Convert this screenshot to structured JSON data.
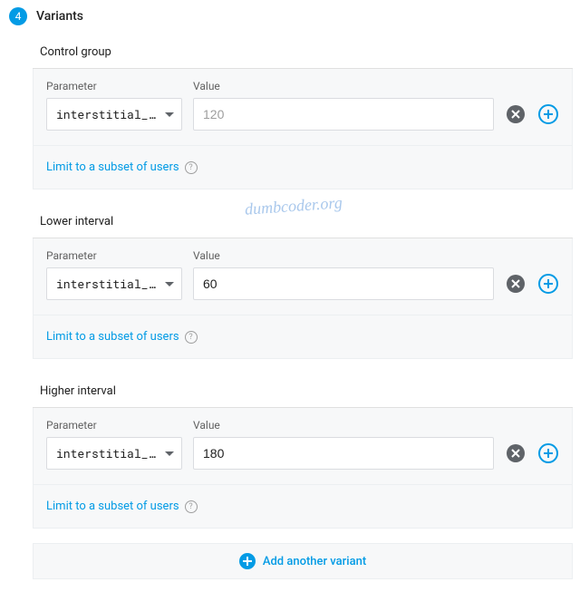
{
  "step": {
    "number": "4",
    "title": "Variants"
  },
  "labels": {
    "parameter": "Parameter",
    "value": "Value",
    "subset": "Limit to a subset of users",
    "addVariant": "Add another variant"
  },
  "placeholders": {
    "value": "120"
  },
  "variants": [
    {
      "title": "Control group",
      "parameter": "interstitial_i…",
      "value": "",
      "isPlaceholder": true
    },
    {
      "title": "Lower interval",
      "parameter": "interstitial_i…",
      "value": "60",
      "isPlaceholder": false
    },
    {
      "title": "Higher interval",
      "parameter": "interstitial_i…",
      "value": "180",
      "isPlaceholder": false
    }
  ],
  "watermark": "dumbcoder.org"
}
